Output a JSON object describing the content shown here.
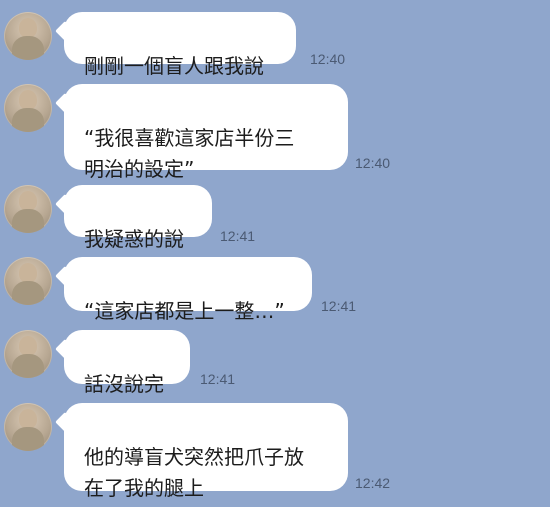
{
  "chat": {
    "background_color": "#8fa6cc",
    "messages": [
      {
        "text": "剛剛一個盲人跟我說",
        "time": "12:40"
      },
      {
        "text": "“我很喜歡這家店半份三\n明治的設定”",
        "time": "12:40"
      },
      {
        "text": "我疑惑的說",
        "time": "12:41"
      },
      {
        "text": "“這家店都是上一整…”",
        "time": "12:41"
      },
      {
        "text": "話沒說完",
        "time": "12:41"
      },
      {
        "text": "他的導盲犬突然把爪子放\n在了我的腿上",
        "time": "12:42"
      }
    ]
  }
}
